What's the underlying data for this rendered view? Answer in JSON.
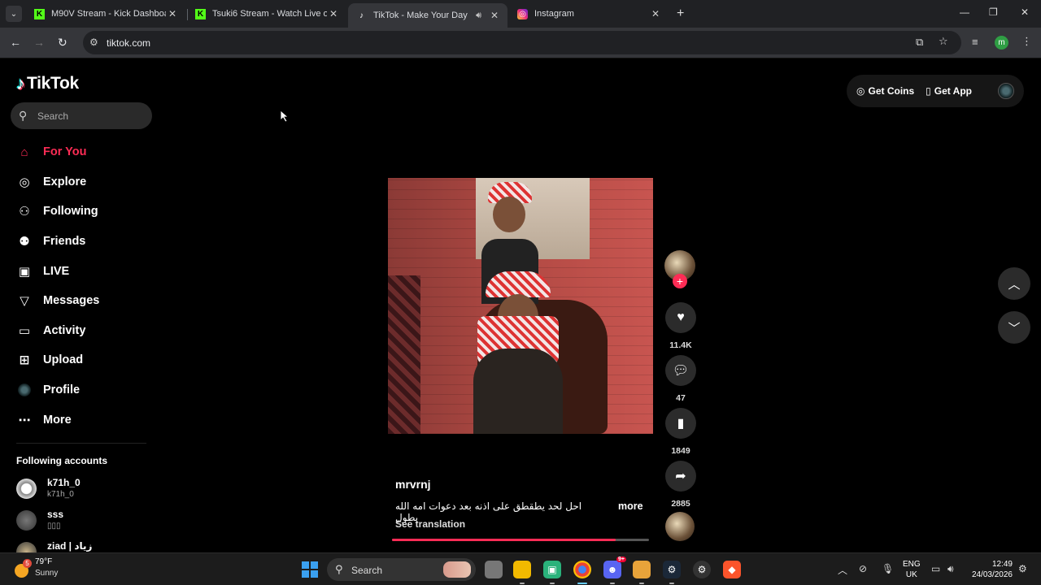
{
  "browser": {
    "tabs": [
      {
        "title": "M90V Stream - Kick Dashboard",
        "favicon": "K"
      },
      {
        "title": "Tsuki6 Stream - Watch Live on Kick",
        "favicon": "K"
      },
      {
        "title": "TikTok - Make Your Day",
        "favicon": "♪"
      },
      {
        "title": "Instagram",
        "favicon": "◎"
      }
    ],
    "url": "tiktok.com",
    "profile_initial": "m"
  },
  "tiktok": {
    "brand": "TikTok",
    "search_placeholder": "Search",
    "nav": [
      {
        "label": "For You",
        "icon": "home-icon"
      },
      {
        "label": "Explore",
        "icon": "compass-icon"
      },
      {
        "label": "Following",
        "icon": "following-icon"
      },
      {
        "label": "Friends",
        "icon": "friends-icon"
      },
      {
        "label": "LIVE",
        "icon": "live-icon"
      },
      {
        "label": "Messages",
        "icon": "messages-icon"
      },
      {
        "label": "Activity",
        "icon": "activity-icon"
      },
      {
        "label": "Upload",
        "icon": "upload-icon"
      },
      {
        "label": "Profile",
        "icon": "profile-icon"
      },
      {
        "label": "More",
        "icon": "more-icon"
      }
    ],
    "following_title": "Following accounts",
    "accounts": [
      {
        "name": "k71h_0",
        "handle": "k71h_0"
      },
      {
        "name": "sss",
        "handle": "▯▯▯"
      },
      {
        "name": "ziad | زياد",
        "handle": ""
      }
    ],
    "get_coins": "Get Coins",
    "get_app": "Get App",
    "accent": "#fe2c55"
  },
  "video": {
    "author": "mrvrnj",
    "caption": "احل لحد يطقطق على اذنه بعد دعوات امه الله يطول",
    "more": "more",
    "see_translation": "See translation",
    "likes": "11.4K",
    "comments": "47",
    "saves": "1849",
    "shares": "2885",
    "progress": 0.87
  },
  "taskbar": {
    "temp": "79°F",
    "weather": "Sunny",
    "weather_badge": "5",
    "search_label": "Search",
    "lang1": "ENG",
    "lang2": "UK",
    "time": "12:49",
    "date": "24/03/2026",
    "discord_badge": "9+"
  }
}
